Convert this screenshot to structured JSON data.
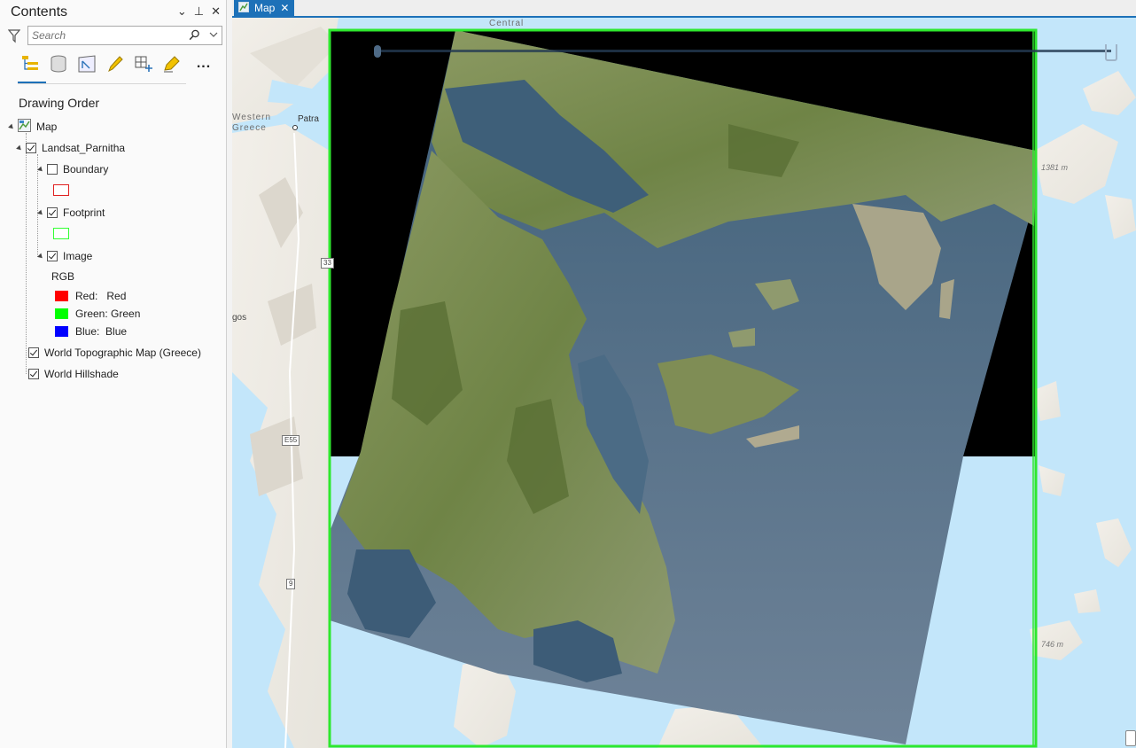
{
  "contents": {
    "title": "Contents",
    "search_placeholder": "Search",
    "section": "Drawing Order",
    "pane_buttons": {
      "menu": "⌄",
      "pin": "⊥",
      "close": "✕"
    },
    "toolbar": [
      {
        "name": "list-by-drawing-order-icon"
      },
      {
        "name": "list-by-data-source-icon"
      },
      {
        "name": "list-by-selection-icon"
      },
      {
        "name": "list-by-editing-icon"
      },
      {
        "name": "list-by-snapping-icon"
      },
      {
        "name": "list-by-labeling-icon"
      }
    ],
    "more": "...",
    "layers": {
      "map": "Map",
      "landsat": "Landsat_Parnitha",
      "boundary": "Boundary",
      "footprint": "Footprint",
      "image": "Image",
      "rgb": "RGB",
      "red": "Red:   Red",
      "green": "Green: Green",
      "blue": "Blue:  Blue",
      "topo": "World Topographic Map (Greece)",
      "hillshade": "World Hillshade"
    },
    "checked": {
      "landsat": true,
      "boundary": false,
      "footprint": true,
      "image": true,
      "topo": true,
      "hillshade": true
    },
    "colors": {
      "boundary": "#e02020",
      "footprint": "#33ff33",
      "red": "#ff0000",
      "green": "#00ff00",
      "blue": "#0000ff"
    }
  },
  "view": {
    "tab": "Map",
    "tab_close": "✕",
    "labels": {
      "central": "Central",
      "western1": "Western",
      "western2": "Greece",
      "patra": "Patra",
      "gos": "gos",
      "elev1": "1381 m",
      "elev2": "746 m",
      "e55": "E55",
      "r9": "9",
      "r33": "33"
    },
    "accent": "#1d71b8",
    "footprint_color": "#2ee82e"
  }
}
